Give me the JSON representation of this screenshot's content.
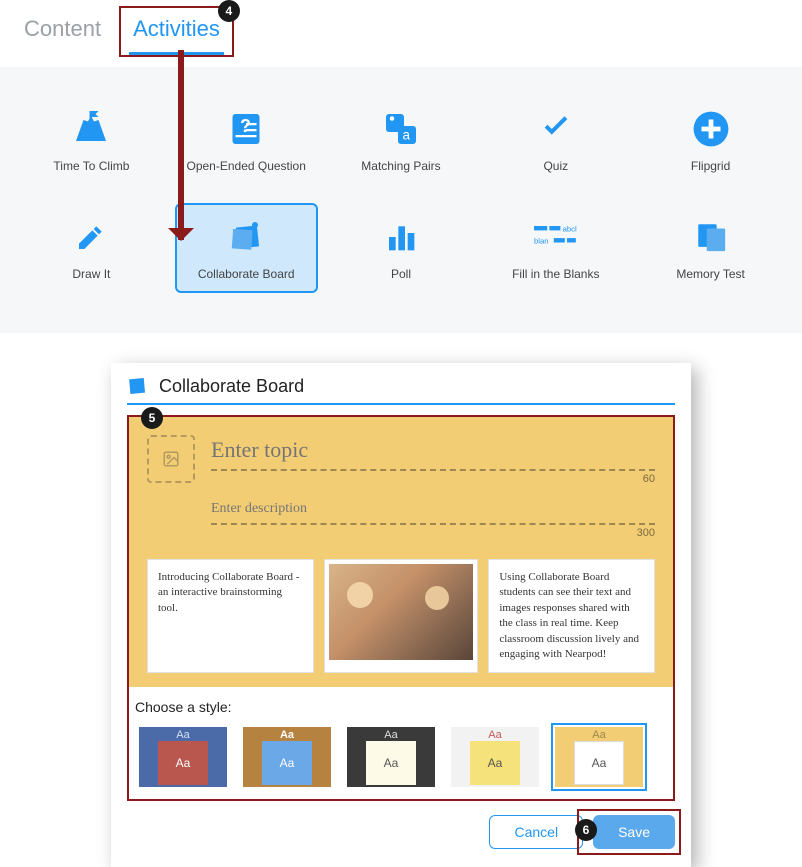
{
  "tabs": {
    "content": "Content",
    "activities": "Activities"
  },
  "steps": {
    "s4": "4",
    "s5": "5",
    "s6": "6"
  },
  "activities": [
    {
      "label": "Time To Climb"
    },
    {
      "label": "Open-Ended Question"
    },
    {
      "label": "Matching Pairs"
    },
    {
      "label": "Quiz"
    },
    {
      "label": "Flipgrid"
    },
    {
      "label": "Draw It"
    },
    {
      "label": "Collaborate Board"
    },
    {
      "label": "Poll"
    },
    {
      "label": "Fill in the Blanks"
    },
    {
      "label": "Memory Test"
    }
  ],
  "editor": {
    "title": "Collaborate Board",
    "topic_placeholder": "Enter topic",
    "topic_limit": "60",
    "desc_placeholder": "Enter description",
    "desc_limit": "300",
    "card1": "Introducing Collaborate Board - an interactive brainstorming tool.",
    "card3": "Using Collaborate Board students can see their text and images responses shared with the class in real time. Keep classroom discussion lively and engaging with Nearpod!",
    "style_label": "Choose a style:",
    "swatch_text": "Aa",
    "cancel": "Cancel",
    "save": "Save"
  }
}
